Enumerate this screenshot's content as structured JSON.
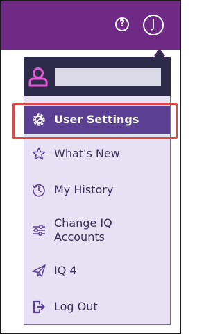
{
  "header": {
    "help_label": "?",
    "profile_initial": "J",
    "bar_color": "#6f2a86"
  },
  "menu": {
    "items": [
      {
        "label": "User Settings",
        "icon": "gear-icon",
        "active": true
      },
      {
        "label": "What's New",
        "icon": "star-icon",
        "active": false
      },
      {
        "label": "My History",
        "icon": "history-icon",
        "active": false
      },
      {
        "label": "Change IQ Accounts",
        "icon": "sliders-icon",
        "active": false
      },
      {
        "label": "IQ 4",
        "icon": "paper-plane-icon",
        "active": false
      },
      {
        "label": "Log Out",
        "icon": "logout-icon",
        "active": false
      }
    ],
    "active_color": "#5a3f92",
    "background_color": "#e8e1f3",
    "highlight_color": "#e04848"
  }
}
